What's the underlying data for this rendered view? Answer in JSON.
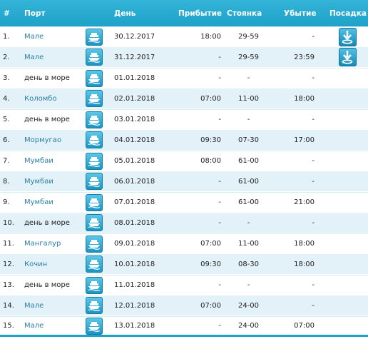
{
  "header": {
    "num": "#",
    "port": "Порт",
    "day": "День",
    "arrival": "Прибытие",
    "stay": "Стоянка",
    "departure": "Убытие",
    "boarding": "Посадка"
  },
  "icons": {
    "ship": "ship-icon",
    "boarding": "boarding-arrow-icon"
  },
  "colors": {
    "header_bg": "#1fa2c8",
    "row_alt_bg": "#e3f2f8",
    "link": "#2b7fa6"
  },
  "rows": [
    {
      "num": "1.",
      "port": "Мале",
      "link": true,
      "day": "30.12.2017",
      "arrival": "18:00",
      "stay": "29-59",
      "departure": "-",
      "boarding": true
    },
    {
      "num": "2.",
      "port": "Мале",
      "link": true,
      "day": "31.12.2017",
      "arrival": "-",
      "stay": "29-59",
      "departure": "23:59",
      "boarding": true
    },
    {
      "num": "3.",
      "port": "день в море",
      "link": false,
      "day": "01.01.2018",
      "arrival": "-",
      "stay": "-",
      "departure": "-",
      "boarding": false
    },
    {
      "num": "4.",
      "port": "Коломбо",
      "link": true,
      "day": "02.01.2018",
      "arrival": "07:00",
      "stay": "11-00",
      "departure": "18:00",
      "boarding": false
    },
    {
      "num": "5.",
      "port": "день в море",
      "link": false,
      "day": "03.01.2018",
      "arrival": "-",
      "stay": "-",
      "departure": "-",
      "boarding": false
    },
    {
      "num": "6.",
      "port": "Мормугао",
      "link": true,
      "day": "04.01.2018",
      "arrival": "09:30",
      "stay": "07-30",
      "departure": "17:00",
      "boarding": false
    },
    {
      "num": "7.",
      "port": "Мумбаи",
      "link": true,
      "day": "05.01.2018",
      "arrival": "08:00",
      "stay": "61-00",
      "departure": "-",
      "boarding": false
    },
    {
      "num": "8.",
      "port": "Мумбаи",
      "link": true,
      "day": "06.01.2018",
      "arrival": "-",
      "stay": "61-00",
      "departure": "-",
      "boarding": false
    },
    {
      "num": "9.",
      "port": "Мумбаи",
      "link": true,
      "day": "07.01.2018",
      "arrival": "-",
      "stay": "61-00",
      "departure": "21:00",
      "boarding": false
    },
    {
      "num": "10.",
      "port": "день в море",
      "link": false,
      "day": "08.01.2018",
      "arrival": "-",
      "stay": "-",
      "departure": "-",
      "boarding": false
    },
    {
      "num": "11.",
      "port": "Мангалур",
      "link": true,
      "day": "09.01.2018",
      "arrival": "07:00",
      "stay": "11-00",
      "departure": "18:00",
      "boarding": false
    },
    {
      "num": "12.",
      "port": "Кочин",
      "link": true,
      "day": "10.01.2018",
      "arrival": "09:30",
      "stay": "08-30",
      "departure": "18:00",
      "boarding": false
    },
    {
      "num": "13.",
      "port": "день в море",
      "link": false,
      "day": "11.01.2018",
      "arrival": "-",
      "stay": "-",
      "departure": "-",
      "boarding": false
    },
    {
      "num": "14.",
      "port": "Мале",
      "link": true,
      "day": "12.01.2018",
      "arrival": "07:00",
      "stay": "24-00",
      "departure": "-",
      "boarding": false
    },
    {
      "num": "15.",
      "port": "Мале",
      "link": true,
      "day": "13.01.2018",
      "arrival": "-",
      "stay": "24-00",
      "departure": "07:00",
      "boarding": false
    }
  ]
}
